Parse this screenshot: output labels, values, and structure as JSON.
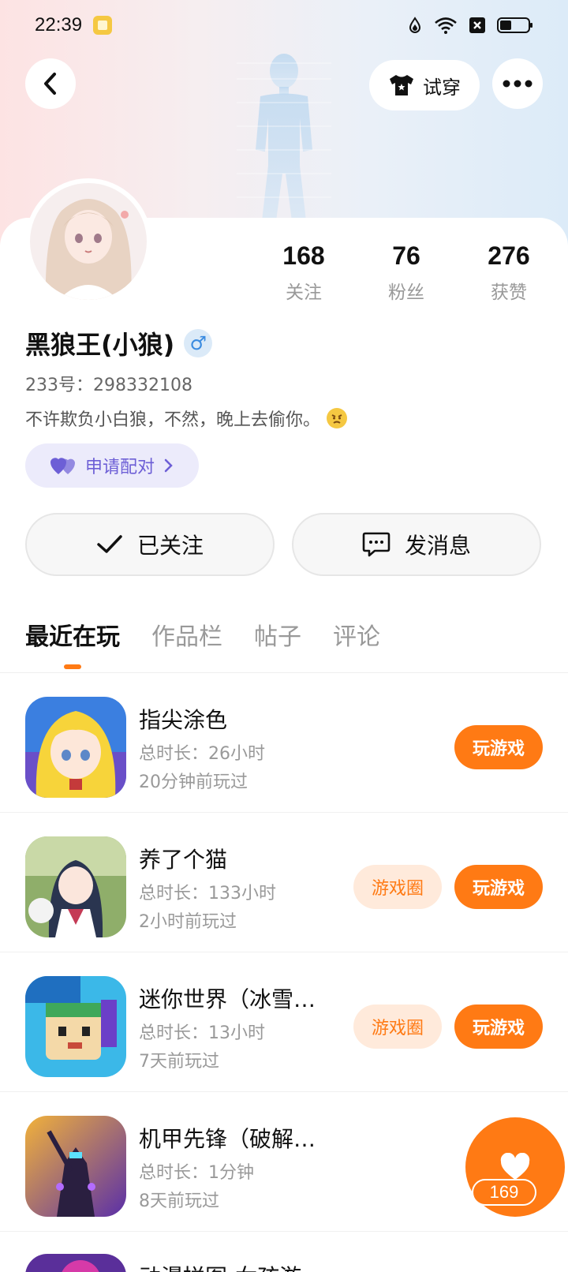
{
  "status_bar": {
    "time": "22:39"
  },
  "header": {
    "try_on_label": "试穿"
  },
  "profile": {
    "name": "黑狼王(小狼)",
    "gender_symbol": "♂",
    "uid": "233号：298332108",
    "bio": "不许欺负小白狼，不然，晚上去偷你。",
    "pair_label": "申请配对",
    "stats": [
      {
        "value": "168",
        "label": "关注"
      },
      {
        "value": "76",
        "label": "粉丝"
      },
      {
        "value": "276",
        "label": "获赞"
      }
    ],
    "follow_label": "已关注",
    "message_label": "发消息"
  },
  "tabs": [
    {
      "label": "最近在玩",
      "active": true
    },
    {
      "label": "作品栏",
      "active": false
    },
    {
      "label": "帖子",
      "active": false
    },
    {
      "label": "评论",
      "active": false
    }
  ],
  "games": [
    {
      "title": "指尖涂色",
      "time": "总时长：26小时",
      "last": "20分钟前玩过",
      "circle": "",
      "play": "玩游戏"
    },
    {
      "title": "养了个猫",
      "time": "总时长：133小时",
      "last": "2小时前玩过",
      "circle": "游戏圈",
      "play": "玩游戏"
    },
    {
      "title": "迷你世界（冰雪奇缘）",
      "time": "总时长：13小时",
      "last": "7天前玩过",
      "circle": "游戏圈",
      "play": "玩游戏"
    },
    {
      "title": "机甲先锋（破解版）",
      "time": "总时长：1分钟",
      "last": "8天前玩过",
      "circle": "",
      "play": ""
    }
  ],
  "partial_game_title": "动漫拼图-女孩游戏 Anime",
  "fab": {
    "count": "169"
  },
  "colors": {
    "accent": "#ff7a14",
    "accent_light": "#ffeadb",
    "pair_bg": "#ecebfb",
    "pair_text": "#6d5fd6"
  }
}
